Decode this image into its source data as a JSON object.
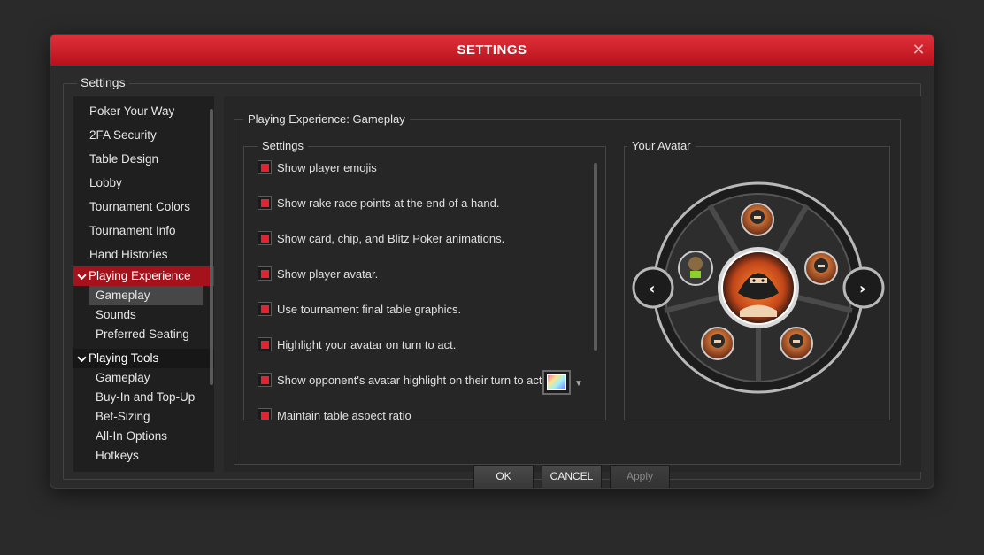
{
  "window": {
    "title": "SETTINGS"
  },
  "outer_legend": "Settings",
  "sidebar": {
    "items": [
      "Poker Your Way",
      "2FA Security",
      "Table Design",
      "Lobby",
      "Tournament Colors",
      "Tournament Info",
      "Hand Histories"
    ],
    "playing_experience": {
      "label": "Playing Experience",
      "subitems": [
        "Gameplay",
        "Sounds",
        "Preferred Seating"
      ],
      "selected": "Gameplay"
    },
    "playing_tools": {
      "label": "Playing Tools",
      "subitems": [
        "Gameplay",
        "Buy-In and Top-Up",
        "Bet-Sizing",
        "All-In Options",
        "Hotkeys"
      ]
    }
  },
  "panel": {
    "legend": "Playing Experience: Gameplay",
    "settings_legend": "Settings",
    "avatar_legend": "Your Avatar",
    "options": [
      {
        "label": "Show player emojis",
        "checked": true
      },
      {
        "label": "Show rake race points at the end of a hand.",
        "checked": true
      },
      {
        "label": "Show card, chip, and Blitz Poker animations.",
        "checked": true
      },
      {
        "label": "Show player avatar.",
        "checked": true
      },
      {
        "label": "Use tournament final table graphics.",
        "checked": true
      },
      {
        "label": "Highlight your avatar on turn to act.",
        "checked": true
      },
      {
        "label": "Show opponent's avatar highlight on their turn to act.",
        "checked": true
      },
      {
        "label": "Maintain table aspect ratio",
        "checked": true
      }
    ]
  },
  "buttons": {
    "ok": "OK",
    "cancel": "CANCEL",
    "apply": "Apply"
  },
  "colors": {
    "accent": "#e3232f",
    "titlebar": "#c41c26",
    "selected_category": "#a5121c"
  }
}
